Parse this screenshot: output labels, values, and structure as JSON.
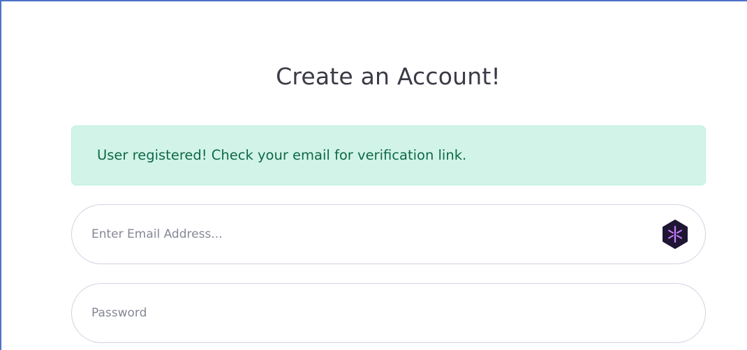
{
  "page": {
    "title": "Create an Account!"
  },
  "alert": {
    "message": "User registered! Check your email for verification link."
  },
  "form": {
    "email": {
      "placeholder": "Enter Email Address...",
      "value": ""
    },
    "password": {
      "placeholder": "Password",
      "value": ""
    },
    "email_extension_icon": "password-manager-icon"
  },
  "colors": {
    "frame_border": "#4e73c7",
    "title_text": "#3a3b45",
    "alert_background": "#d2f4e8",
    "alert_text": "#0f6848",
    "input_border": "#d1d3e2",
    "placeholder_text": "#858796",
    "extension_icon_bg": "#1f1633",
    "extension_icon_accent": "#c77dff"
  }
}
